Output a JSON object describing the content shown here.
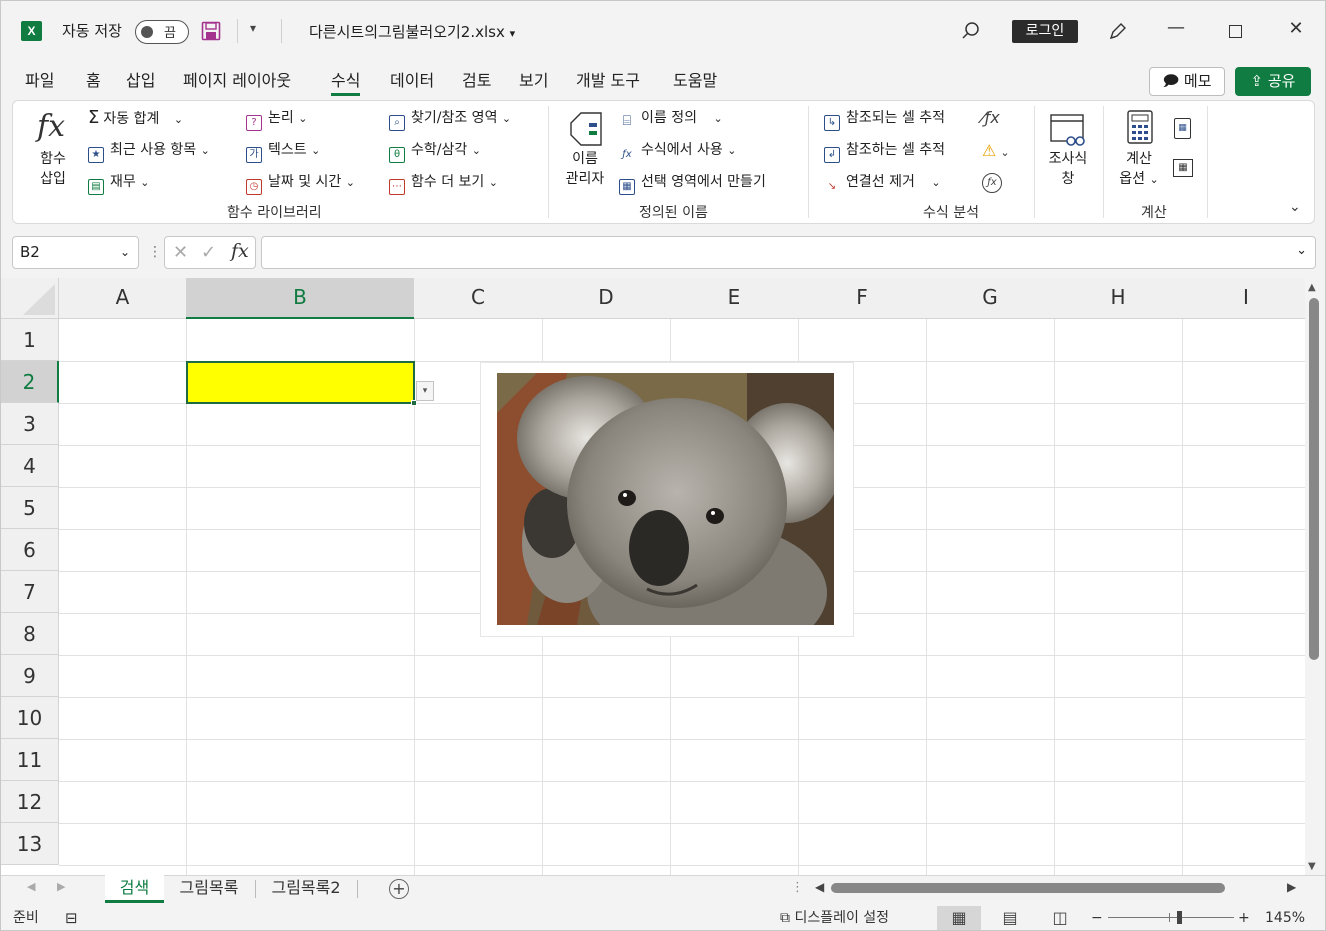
{
  "titlebar": {
    "autosave_label": "자동 저장",
    "autosave_state": "끔",
    "filename": "다른시트의그림불러오기2.xlsx",
    "login_label": "로그인"
  },
  "tabs": [
    "파일",
    "홈",
    "삽입",
    "페이지 레이아웃",
    "수식",
    "데이터",
    "검토",
    "보기",
    "개발 도구",
    "도움말"
  ],
  "active_tab": "수식",
  "memo_label": "메모",
  "share_label": "공유",
  "ribbon": {
    "insert_function": [
      "함수",
      "삽입"
    ],
    "lib_col1": [
      "자동 합계",
      "최근 사용 항목",
      "재무"
    ],
    "lib_col2": [
      "논리",
      "텍스트",
      "날짜 및 시간"
    ],
    "lib_col3": [
      "찾기/참조 영역",
      "수학/삼각",
      "함수 더 보기"
    ],
    "lib_group": "함수 라이브러리",
    "name_manager": [
      "이름",
      "관리자"
    ],
    "names_items": [
      "이름 정의",
      "수식에서 사용",
      "선택 영역에서 만들기"
    ],
    "names_group": "정의된 이름",
    "audit_items": [
      "참조되는 셀 추적",
      "참조하는 셀 추적",
      "연결선 제거"
    ],
    "audit_group": "수식 분석",
    "watch": [
      "조사식",
      "창"
    ],
    "calc_options": [
      "계산",
      "옵션"
    ],
    "calc_group": "계산"
  },
  "namebox": "B2",
  "columns": [
    "A",
    "B",
    "C",
    "D",
    "E",
    "F",
    "G",
    "H",
    "I"
  ],
  "rows": [
    "1",
    "2",
    "3",
    "4",
    "5",
    "6",
    "7",
    "8",
    "9",
    "10",
    "11",
    "12",
    "13"
  ],
  "selected_cell": "B2",
  "sheets": [
    "검색",
    "그림목록",
    "그림목록2"
  ],
  "active_sheet": "검색",
  "status": {
    "ready": "준비",
    "display_settings": "디스플레이 설정",
    "zoom": "145%"
  },
  "colors": {
    "accent": "#107c41",
    "cell_fill": "#ffff00"
  }
}
